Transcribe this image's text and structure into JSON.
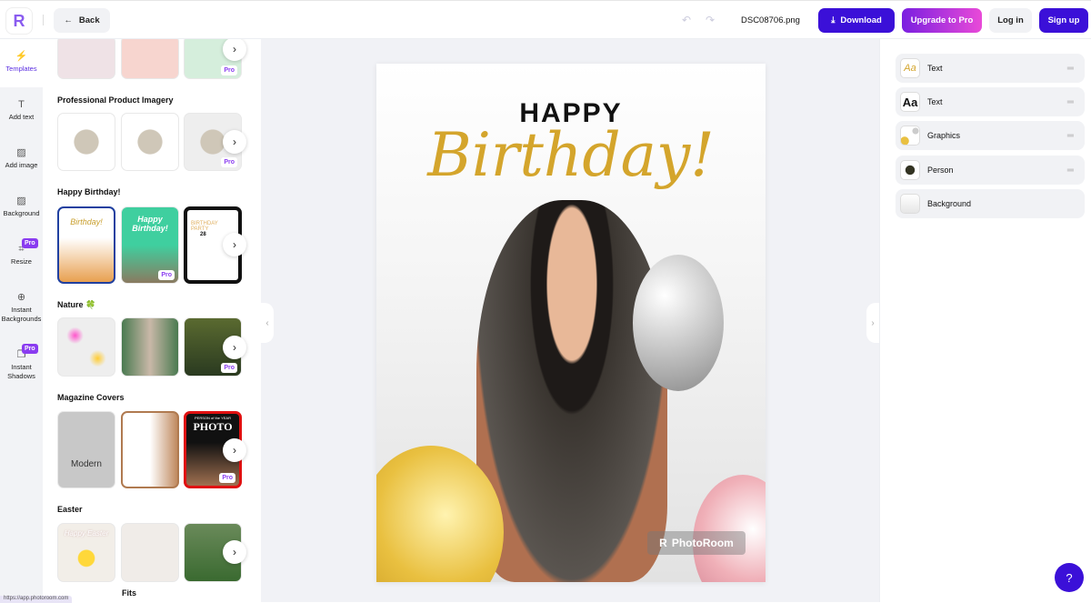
{
  "topbar": {
    "back_label": "Back",
    "filename": "DSC08706.png",
    "download_label": "Download",
    "upgrade_label": "Upgrade to Pro",
    "login_label": "Log in",
    "signup_label": "Sign up",
    "logo_letter": "R"
  },
  "rail": [
    {
      "label": "Templates",
      "icon": "templates-icon"
    },
    {
      "label": "Add text",
      "icon": "text-icon"
    },
    {
      "label": "Add image",
      "icon": "image-icon"
    },
    {
      "label": "Background",
      "icon": "background-icon"
    },
    {
      "label": "Resize",
      "icon": "crop-icon",
      "pro": "Pro"
    },
    {
      "label": "Instant Backgrounds",
      "icon": "instant-backgrounds-icon"
    },
    {
      "label": "Instant Shadows",
      "icon": "shadow-icon",
      "pro": "Pro"
    }
  ],
  "panel": {
    "pro_label": "Pro",
    "sections": [
      {
        "title": "Professional Product Imagery"
      },
      {
        "title": "Happy Birthday!"
      },
      {
        "title": "Nature 🍀"
      },
      {
        "title": "Magazine Covers"
      },
      {
        "title": "Easter"
      },
      {
        "title": "Fits"
      }
    ],
    "thumb_text": {
      "birthday_1": "Birthday!",
      "birthday_2": "Happy Birthday!",
      "birthday_3": "BIRTHDAY PARTY",
      "birthday_3_date": "28",
      "magazine_1": "Modern",
      "magazine_3": "PHOTO",
      "magazine_3_top": "PERSON of the YEAR",
      "easter_1": "Happy Easter"
    }
  },
  "canvas": {
    "happy": "HAPPY",
    "birthday": "Birthday!",
    "watermark": "PhotoRoom"
  },
  "layers": [
    {
      "label": "Text",
      "thumb": "Aa"
    },
    {
      "label": "Text",
      "thumb": "Aa"
    },
    {
      "label": "Graphics",
      "thumb": ""
    },
    {
      "label": "Person",
      "thumb": ""
    },
    {
      "label": "Background",
      "thumb": ""
    }
  ],
  "status_url": "https://app.photoroom.com",
  "colors": {
    "primary": "#3b10d8",
    "accent": "#8a3cf0",
    "gold": "#d4a52c"
  }
}
